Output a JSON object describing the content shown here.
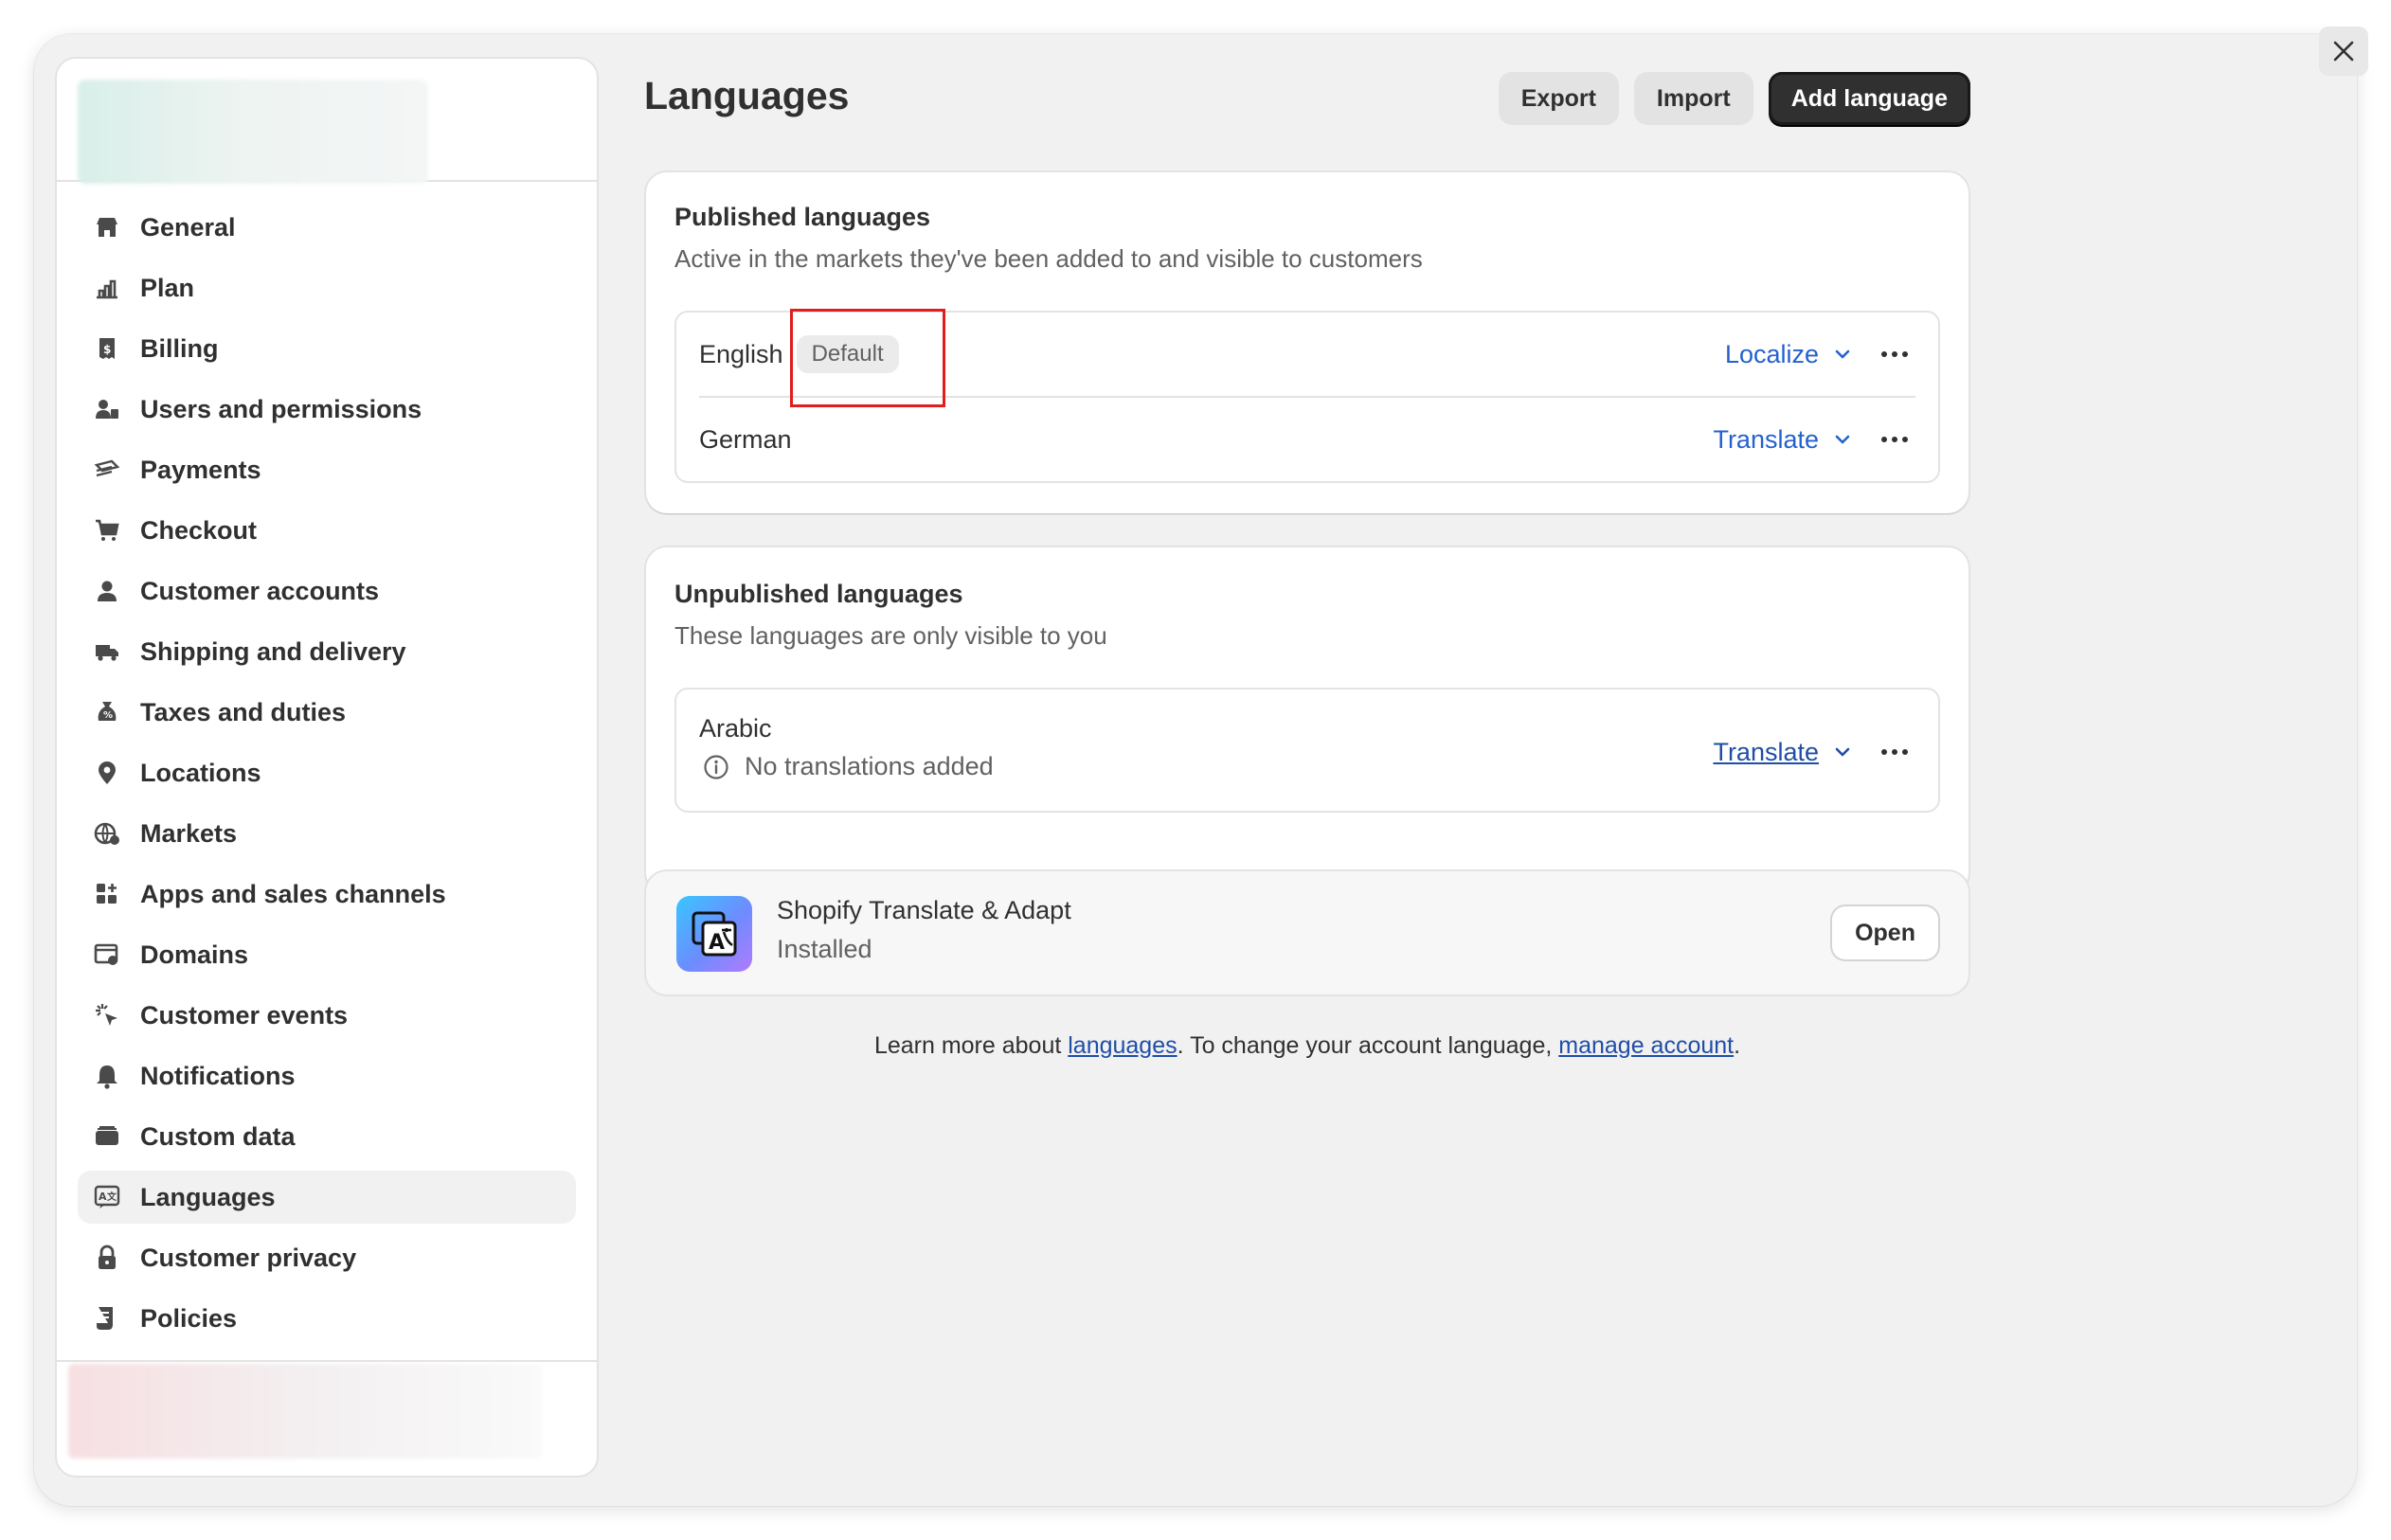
{
  "window": {
    "close_label": "×"
  },
  "sidebar": {
    "items": [
      {
        "label": "General",
        "icon": "store-icon"
      },
      {
        "label": "Plan",
        "icon": "plan-icon"
      },
      {
        "label": "Billing",
        "icon": "billing-icon"
      },
      {
        "label": "Users and permissions",
        "icon": "users-icon"
      },
      {
        "label": "Payments",
        "icon": "payments-icon"
      },
      {
        "label": "Checkout",
        "icon": "cart-icon"
      },
      {
        "label": "Customer accounts",
        "icon": "person-icon"
      },
      {
        "label": "Shipping and delivery",
        "icon": "truck-icon"
      },
      {
        "label": "Taxes and duties",
        "icon": "tax-icon"
      },
      {
        "label": "Locations",
        "icon": "location-icon"
      },
      {
        "label": "Markets",
        "icon": "globe-icon"
      },
      {
        "label": "Apps and sales channels",
        "icon": "apps-icon"
      },
      {
        "label": "Domains",
        "icon": "domains-icon"
      },
      {
        "label": "Customer events",
        "icon": "cursor-icon"
      },
      {
        "label": "Notifications",
        "icon": "bell-icon"
      },
      {
        "label": "Custom data",
        "icon": "data-icon"
      },
      {
        "label": "Languages",
        "icon": "language-icon",
        "active": true
      },
      {
        "label": "Customer privacy",
        "icon": "lock-icon"
      },
      {
        "label": "Policies",
        "icon": "policies-icon"
      }
    ]
  },
  "header": {
    "title": "Languages",
    "export_label": "Export",
    "import_label": "Import",
    "add_label": "Add language"
  },
  "published": {
    "title": "Published languages",
    "subtitle": "Active in the markets they've been added to and visible to customers",
    "rows": [
      {
        "name": "English",
        "badge": "Default",
        "action": "Localize"
      },
      {
        "name": "German",
        "action": "Translate"
      }
    ]
  },
  "unpublished": {
    "title": "Unpublished languages",
    "subtitle": "These languages are only visible to you",
    "rows": [
      {
        "name": "Arabic",
        "note": "No translations added",
        "action": "Translate"
      }
    ]
  },
  "app": {
    "name": "Shopify Translate & Adapt",
    "status": "Installed",
    "open_label": "Open"
  },
  "footer": {
    "prefix": "Learn more about ",
    "link1": "languages",
    "middle": ". To change your account language, ",
    "link2": "manage account",
    "suffix": "."
  },
  "colors": {
    "link": "#2461ce",
    "highlight": "#e11d1d",
    "primary_button": "#303030"
  }
}
